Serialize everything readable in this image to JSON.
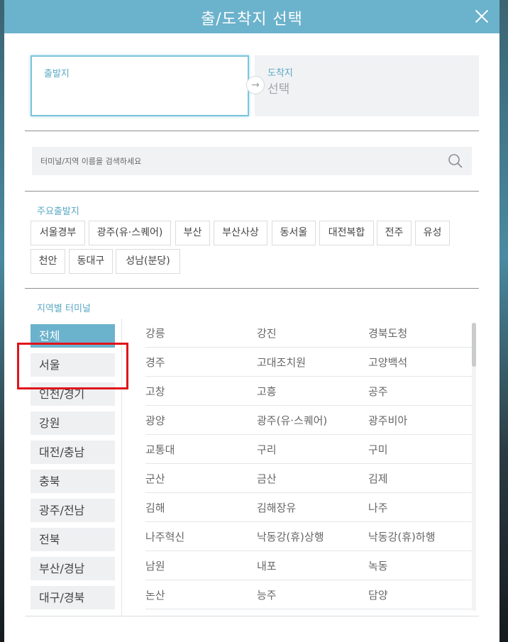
{
  "modal": {
    "title": "출/도착지 선택"
  },
  "route": {
    "depart_label": "출발지",
    "arrow": "→",
    "arrive_label": "도착지",
    "arrive_value": "선택"
  },
  "search": {
    "placeholder": "터미널/지역 이름을 검색하세요"
  },
  "main_departures": {
    "title": "주요출발지",
    "chips": [
      "서울경부",
      "광주(유·스퀘어)",
      "부산",
      "부산사상",
      "동서울",
      "대전복합",
      "전주",
      "유성",
      "천안",
      "동대구",
      "성남(분당)"
    ]
  },
  "regions": {
    "title": "지역별 터미널",
    "items": [
      "전체",
      "서울",
      "인천/경기",
      "강원",
      "대전/충남",
      "충북",
      "광주/전남",
      "전북",
      "부산/경남",
      "대구/경북"
    ],
    "active": "전체"
  },
  "terminals": [
    [
      "강릉",
      "강진",
      "경북도청"
    ],
    [
      "경주",
      "고대조치원",
      "고양백석"
    ],
    [
      "고창",
      "고흥",
      "공주"
    ],
    [
      "광양",
      "광주(유·스퀘어)",
      "광주비아"
    ],
    [
      "교통대",
      "구리",
      "구미"
    ],
    [
      "군산",
      "금산",
      "김제"
    ],
    [
      "김해",
      "김해장유",
      "나주"
    ],
    [
      "나주혁신",
      "낙동강(휴)상행",
      "낙동강(휴)하행"
    ],
    [
      "남원",
      "내포",
      "녹동"
    ],
    [
      "논산",
      "능주",
      "담양"
    ]
  ],
  "colors": {
    "header": "#6bb2cc",
    "accent_text": "#5aa9c4",
    "highlight": "#e0141b"
  }
}
